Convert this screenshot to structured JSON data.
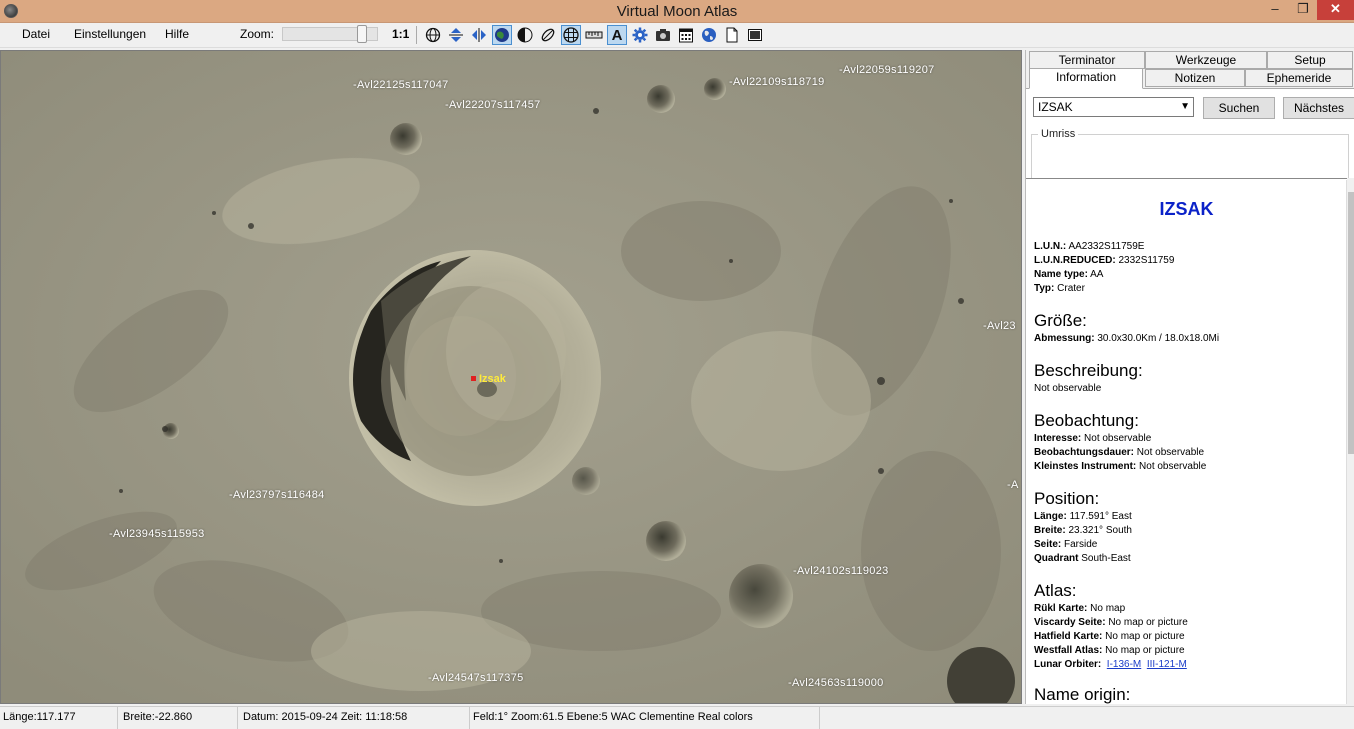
{
  "window": {
    "title": "Virtual Moon Atlas",
    "minimize": "–",
    "maximize": "❐",
    "close": "✕"
  },
  "menu": {
    "datei": "Datei",
    "einstellungen": "Einstellungen",
    "hilfe": "Hilfe",
    "zoom_label": "Zoom:",
    "zoom_reset": "1:1"
  },
  "toolbar": {
    "icons": [
      "grid-globe-icon",
      "flip-vertical-icon",
      "flip-horizontal-icon",
      "earth-view-icon",
      "moon-phase-icon",
      "libration-icon",
      "grid-overlay-icon",
      "ruler-icon",
      "label-text-icon",
      "settings-gear-icon",
      "camera-icon",
      "calendar-icon",
      "globe-icon",
      "new-document-icon",
      "fullscreen-icon"
    ],
    "label_button": "A",
    "zoom_level": 0.88
  },
  "map": {
    "target_label": "Izsak",
    "labels": [
      "-Avl22125s117047",
      "-Avl22207s117457",
      "-Avl22109s118719",
      "-Avl22059s119207",
      "-Avl23",
      "-Avl23797s116484",
      "-Avl23945s115953",
      "-Avl24102s119023",
      "-Avl24547s117375",
      "-Avl24563s119000",
      "-A"
    ]
  },
  "panel": {
    "tabs_top": [
      "Terminator",
      "Werkzeuge",
      "Setup"
    ],
    "tabs_bottom": [
      "Information",
      "Notizen",
      "Ephemeride"
    ],
    "select_value": "IZSAK",
    "search_button": "Suchen",
    "next_button": "Nächstes",
    "umriss_label": "Umriss",
    "info": {
      "name": "IZSAK",
      "lun_key": "L.U.N.:",
      "lun_val": "AA2332S11759E",
      "lunr_key": "L.U.N.REDUCED:",
      "lunr_val": "2332S11759",
      "nametype_key": "Name type:",
      "nametype_val": "AA",
      "typ_key": "Typ:",
      "typ_val": "Crater",
      "h_groesse": "Größe:",
      "abm_key": "Abmessung:",
      "abm_val": "30.0x30.0Km / 18.0x18.0Mi",
      "h_beschreibung": "Beschreibung:",
      "beschreibung_val": "Not observable",
      "h_beobachtung": "Beobachtung:",
      "interesse_key": "Interesse:",
      "interesse_val": "Not observable",
      "dauer_key": "Beobachtungsdauer:",
      "dauer_val": "Not observable",
      "instr_key": "Kleinstes Instrument:",
      "instr_val": "Not observable",
      "h_position": "Position:",
      "laenge_key": "Länge:",
      "laenge_val": "117.591° East",
      "breite_key": "Breite:",
      "breite_val": "23.321° South",
      "seite_key": "Seite:",
      "seite_val": "Farside",
      "quadrant_key": "Quadrant",
      "quadrant_val": "South-East",
      "h_atlas": "Atlas:",
      "rukl_key": "Rükl Karte:",
      "rukl_val": "No map",
      "viscardy_key": "Viscardy Seite:",
      "viscardy_val": "No map or picture",
      "hatfield_key": "Hatfield Karte:",
      "hatfield_val": "No map or picture",
      "westfall_key": "Westfall Atlas:",
      "westfall_val": "No map or picture",
      "orbiter_key": "Lunar Orbiter:",
      "orbiter_link1": "I-136-M",
      "orbiter_link2": "III-121-M",
      "h_name_origin": "Name origin:"
    }
  },
  "status": {
    "laenge": "Länge:117.177",
    "breite": "Breite:-22.860",
    "datum": "Datum:  2015-09-24   Zeit:  11:18:58",
    "feld": "Feld:1° Zoom:61.5   Ebene:5 WAC Clementine Real colors"
  }
}
